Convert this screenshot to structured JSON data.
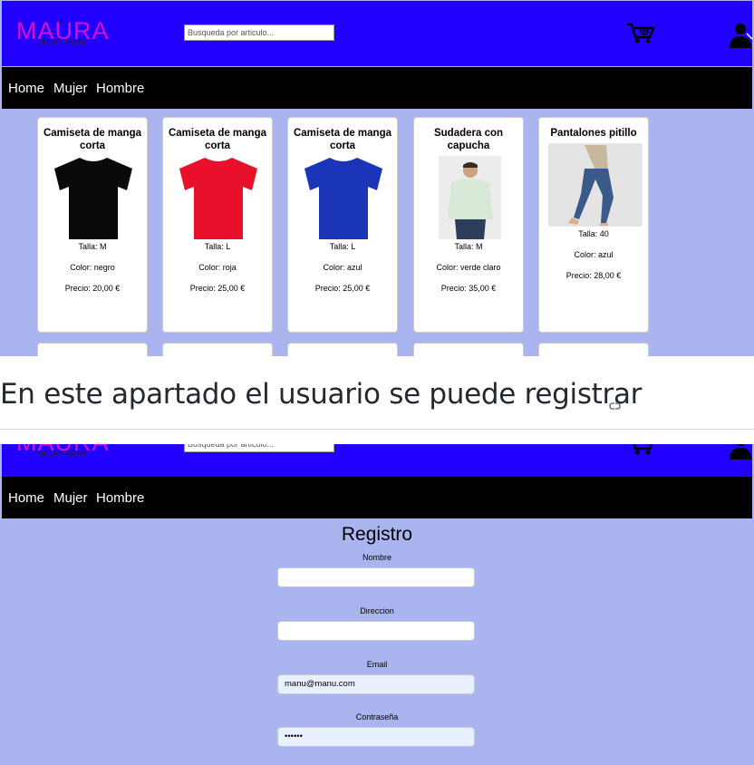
{
  "brand": {
    "logo_text": "MAURA",
    "logo_sub": "SPORT WEAR",
    "logo_mark": "♪"
  },
  "search": {
    "placeholder": "Busqueda por articulo..."
  },
  "nav": {
    "items": [
      "Home",
      "Mujer",
      "Hombre"
    ]
  },
  "products": [
    {
      "title": "Camiseta de manga corta",
      "talla": "Talla: M",
      "color": "Color: negro",
      "precio": "Precio: 20,00 €",
      "swatch": "#0a0a0a",
      "image": "tshirt"
    },
    {
      "title": "Camiseta de manga corta",
      "talla": "Talla: L",
      "color": "Color: roja",
      "precio": "Precio: 25,00 €",
      "swatch": "#e8102a",
      "image": "tshirt"
    },
    {
      "title": "Camiseta de manga corta",
      "talla": "Talla: L",
      "color": "Color: azul",
      "precio": "Precio: 25,00 €",
      "swatch": "#1a35b8",
      "image": "tshirt"
    },
    {
      "title": "Sudadera con capucha",
      "talla": "Talla: M",
      "color": "Color: verde claro",
      "precio": "Precio: 35,00 €",
      "swatch": "#d8e8d6",
      "image": "photo"
    },
    {
      "title": "Pantalones pitillo",
      "talla": "Talla: 40",
      "color": "Color: azul",
      "precio": "Precio: 28,00 €",
      "swatch": "#3a5a8a",
      "image": "photo"
    }
  ],
  "caption": {
    "heading": "En este apartado el usuario se puede registrar",
    "link_icon": "link-icon"
  },
  "registro": {
    "title": "Registro",
    "fields": [
      {
        "label": "Nombre",
        "value": ""
      },
      {
        "label": "Direccion",
        "value": ""
      },
      {
        "label": "Email",
        "value": "manu@manu.com"
      },
      {
        "label": "Contraseña",
        "value": "••••••"
      }
    ]
  },
  "colors": {
    "header": "#2200ff",
    "nav": "#000000",
    "page_bg": "#aab4ef",
    "logo": "#d810c8"
  }
}
